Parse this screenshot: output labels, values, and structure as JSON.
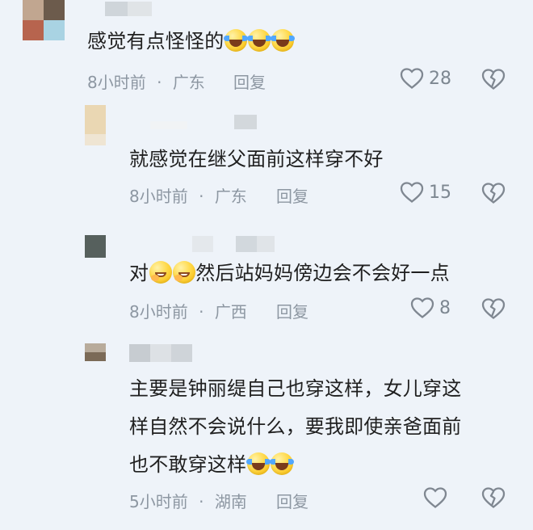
{
  "comments": [
    {
      "text": "感觉有点怪怪的",
      "emojis": [
        "laugh-cry",
        "laugh-cry",
        "laugh-cry"
      ],
      "time": "8小时前",
      "separator": "·",
      "location": "广东",
      "reply_label": "回复",
      "like_count": "28",
      "avatar_colors": [
        "#c1a690",
        "#6c5b4c",
        "#b7644e",
        "#a9d3e3"
      ],
      "username_colors": [
        "#cfd5da",
        "#e0e4e7"
      ]
    },
    {
      "text": "就感觉在继父面前这样穿不好",
      "emojis": [],
      "time": "8小时前",
      "separator": "·",
      "location": "广东",
      "reply_label": "回复",
      "like_count": "15",
      "avatar_colors": [
        "#ead7b3",
        "#efe5d3"
      ],
      "username_colors": [
        "#d9dde2",
        "#f1f3f5",
        "#d3d8dc"
      ]
    },
    {
      "text_before": "对",
      "emojis": [
        "grin",
        "grin"
      ],
      "text_after": "然后站妈妈傍边会不会好一点",
      "time": "8小时前",
      "separator": "·",
      "location": "广西",
      "reply_label": "回复",
      "like_count": "8",
      "avatar_colors": [
        "#56605d",
        "#77817d"
      ],
      "username_colors": [
        "#d2d8dd",
        "#c8ced3",
        "#d9dee3"
      ]
    },
    {
      "lines": [
        "主要是钟丽缇自己也穿这样，女儿穿这",
        "样自然不会说什么，要我即使亲爸面前",
        "也不敢穿这样"
      ],
      "emojis": [
        "laugh-cry",
        "laugh-cry"
      ],
      "time": "5小时前",
      "separator": "·",
      "location": "湖南",
      "reply_label": "回复",
      "like_count": "",
      "avatar_colors": [
        "#7b6a57",
        "#b8ab9b"
      ],
      "username_colors": [
        "#c7ccd1",
        "#dde1e5",
        "#cfd4d9"
      ]
    }
  ]
}
